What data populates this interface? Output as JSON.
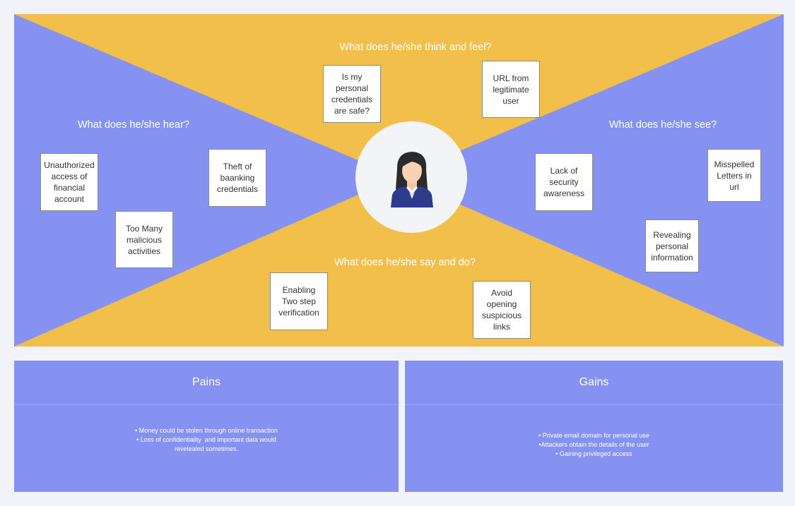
{
  "colors": {
    "yellow": "#f2c04a",
    "purple": "#8592f2",
    "white": "#ffffff"
  },
  "map": {
    "think_feel": "What does he/she think and feel?",
    "hear": "What does he/she hear?",
    "see": "What does he/she see?",
    "say_do": "What does he/she say and do?"
  },
  "notes": {
    "think_1": "Is my\npersonal\ncredentials\nare safe?",
    "think_2": "URL from\nlegitimate\nuser",
    "hear_1": "Unauthorized\naccess of\nfinancial\naccount",
    "hear_2": "Theft of\nbaanking\ncredentials",
    "hear_3": "Too Many\nmalicious\nactivities",
    "see_1": "Lack of\nsecurity\nawareness",
    "see_2": "Misspelled\nLetters in\nurl",
    "see_3": "Revealing\npersonal\ninformation",
    "say_1": "Enabling\nTwo step\nverification",
    "say_2": "Avoid\nopening\nsuspicious\nlinks"
  },
  "avatar": {
    "icon": "user-avatar-icon"
  },
  "pains": {
    "title": "Pains",
    "items": [
      "• Money could be stolen through online transaction",
      "• Loss of confidentiality  and important data would",
      "revelealed sometimes."
    ]
  },
  "gains": {
    "title": "Gains",
    "items": [
      "• Private email domain for personal use",
      "•Attackers obtain the details of the user",
      "• Gaining privileged access"
    ]
  }
}
